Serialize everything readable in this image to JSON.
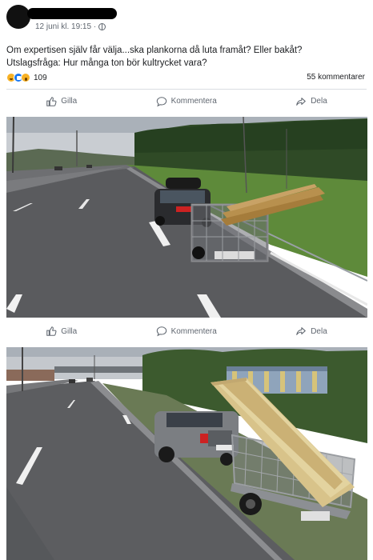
{
  "post": {
    "timestamp": "12 juni kl. 19:15 ·",
    "text_line1": "Om expertisen själv får välja...ska plankorna då luta framåt? Eller bakåt?",
    "text_line2": "Utslagsfråga: Hur många ton bör kultrycket vara?",
    "reaction_count": "109",
    "comment_count": "55 kommentarer",
    "reactions": [
      "haha-icon",
      "like-icon",
      "wow-icon"
    ]
  },
  "actions": {
    "like": "Gilla",
    "comment": "Kommentera",
    "share": "Dela"
  },
  "colors": {
    "accent": "#1877f2",
    "secondary_text": "#606770",
    "divider": "#dadde1"
  }
}
